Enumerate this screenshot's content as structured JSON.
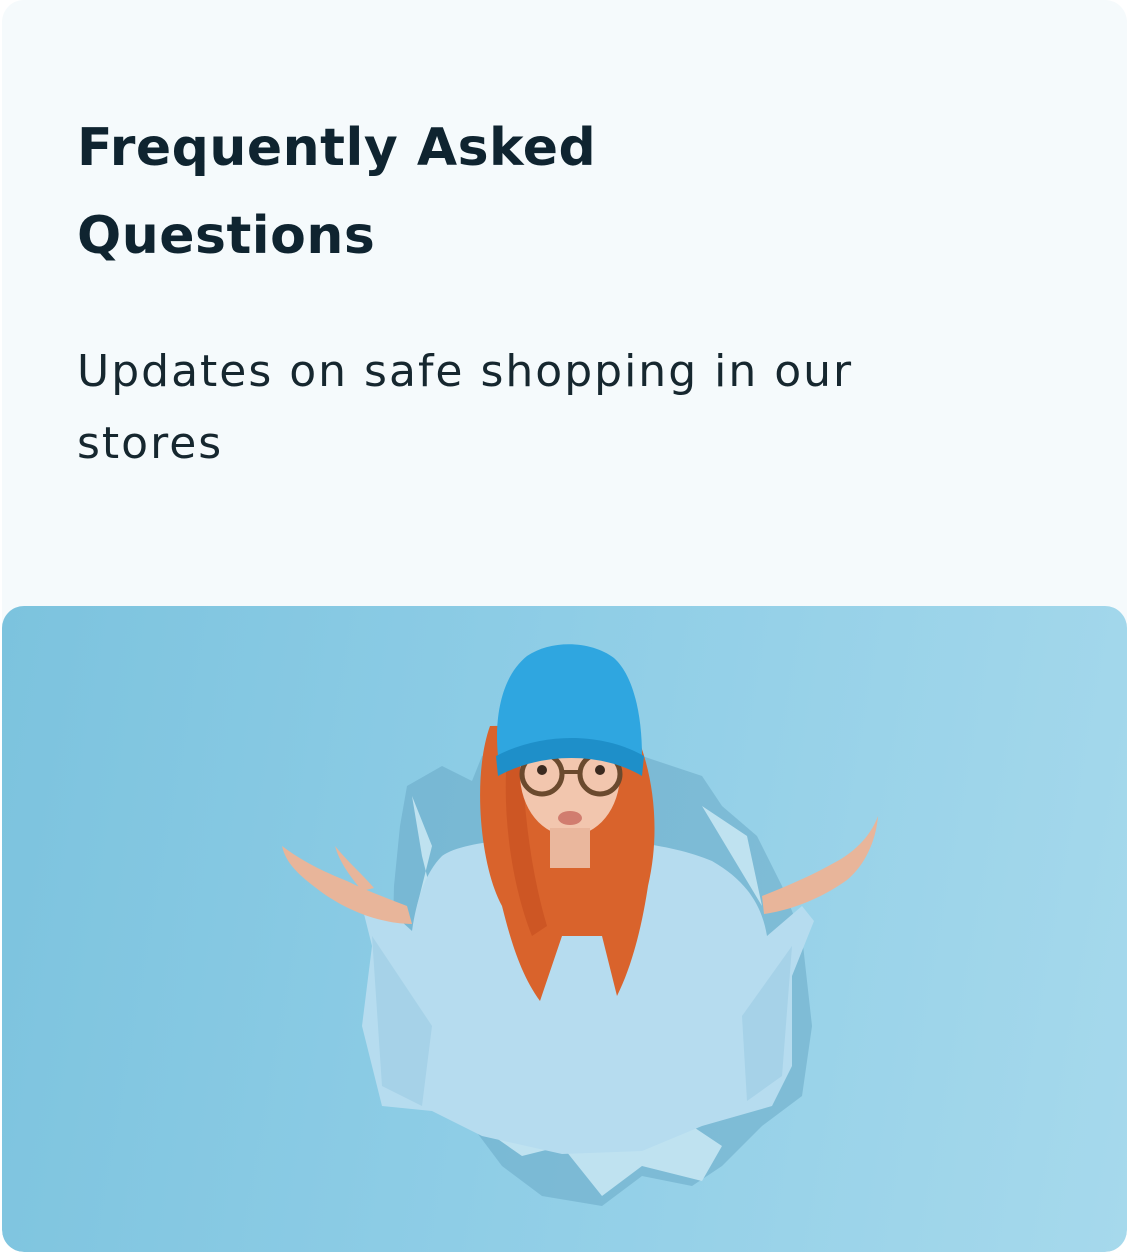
{
  "faq": {
    "title": "Frequently Asked Questions",
    "subtitle": "Updates on safe shopping in our stores"
  },
  "colors": {
    "card_background": "#f5fafc",
    "title_text": "#0f2430",
    "image_background": "#8ecde6"
  },
  "hero_image": {
    "description_icon": "confused-shrug-person-image"
  }
}
